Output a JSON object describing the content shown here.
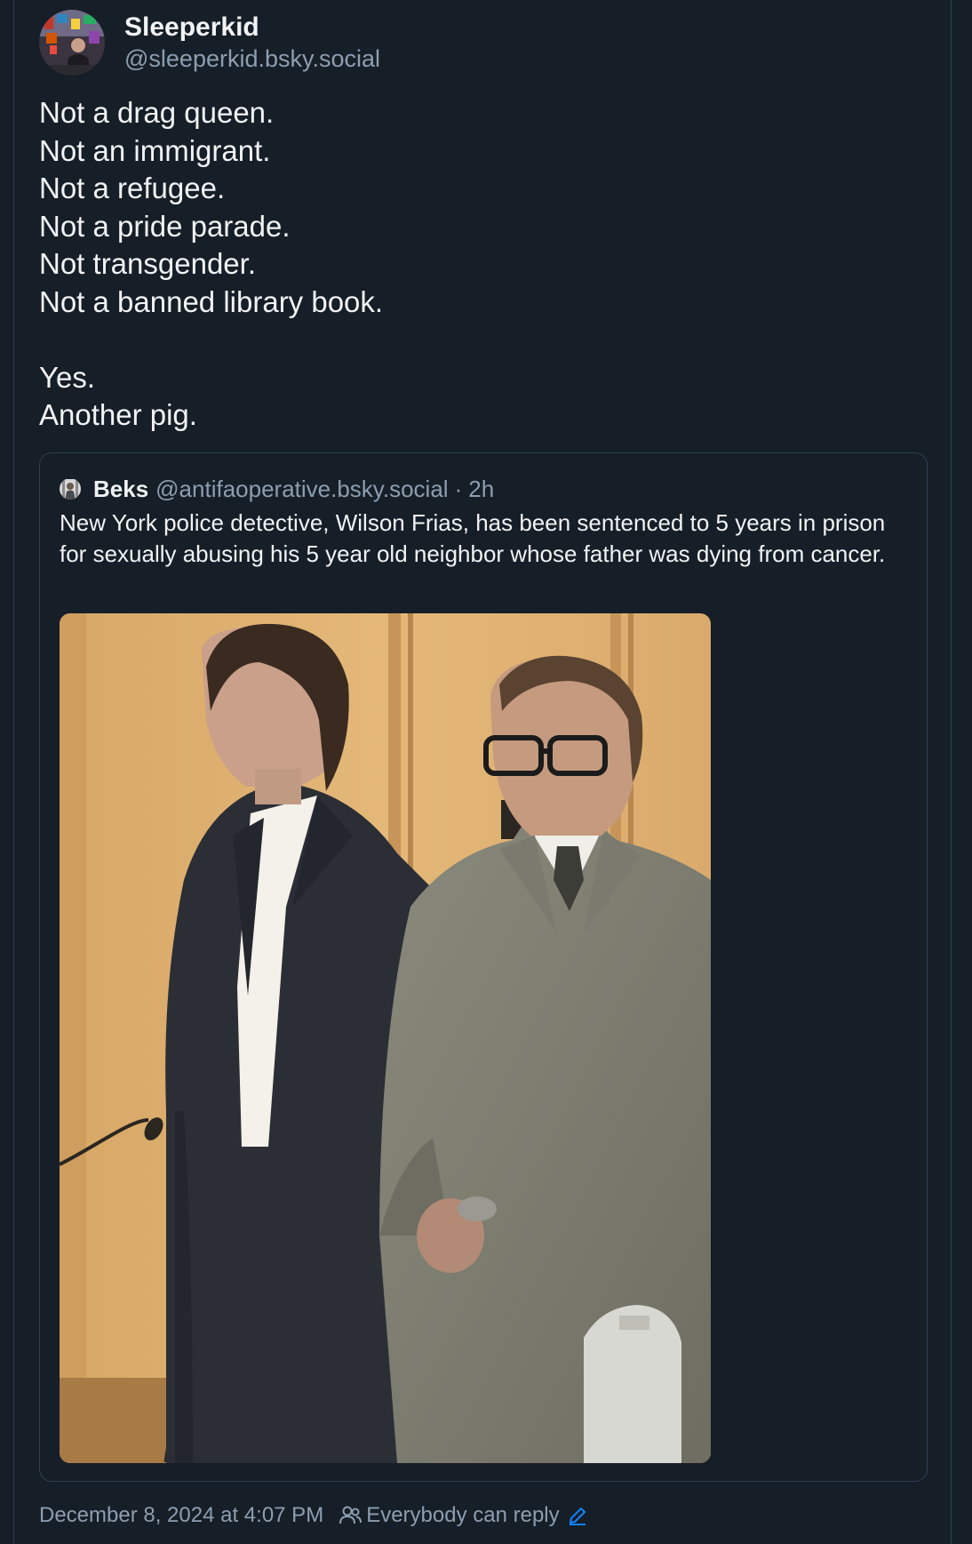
{
  "post": {
    "author": {
      "display_name": "Sleeperkid",
      "handle": "@sleeperkid.bsky.social"
    },
    "text": "Not a drag queen.\nNot an immigrant.\nNot a refugee.\nNot a pride parade.\nNot transgender.\nNot a banned library book.\n\nYes.\nAnother pig.",
    "timestamp": "December 8, 2024 at 4:07 PM",
    "reply_setting": "Everybody can reply",
    "icons": {
      "reply_setting": "people-icon",
      "edit": "pencil-icon"
    }
  },
  "quote": {
    "author": {
      "display_name": "Beks",
      "handle": "@antifaoperative.bsky.social",
      "separator": "·",
      "age": "2h"
    },
    "text": "New York police detective, Wilson Frias, has been sentenced to 5 years in prison for sexually abusing his 5 year old neighbor whose father was dying from cancer."
  },
  "colors": {
    "background": "#161e27",
    "border": "#2e4052",
    "primary_text": "#f1f3f5",
    "secondary_text": "#8d9eb0",
    "accent": "#1083fe"
  }
}
